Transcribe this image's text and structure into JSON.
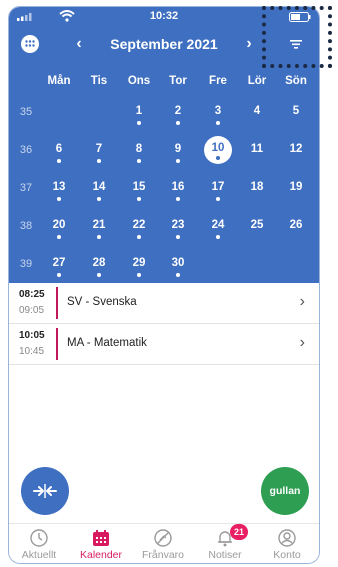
{
  "status": {
    "time": "10:32"
  },
  "header": {
    "month_title": "September 2021",
    "prev": "‹",
    "next": "›"
  },
  "weekdays": [
    "Mån",
    "Tis",
    "Ons",
    "Tor",
    "Fre",
    "Lör",
    "Sön"
  ],
  "weeks": [
    {
      "number": "35",
      "days": [
        {
          "n": "",
          "dot": false
        },
        {
          "n": "",
          "dot": false
        },
        {
          "n": "1",
          "dot": true
        },
        {
          "n": "2",
          "dot": true
        },
        {
          "n": "3",
          "dot": true
        },
        {
          "n": "4",
          "dot": false
        },
        {
          "n": "5",
          "dot": false
        }
      ]
    },
    {
      "number": "36",
      "days": [
        {
          "n": "6",
          "dot": true
        },
        {
          "n": "7",
          "dot": true
        },
        {
          "n": "8",
          "dot": true
        },
        {
          "n": "9",
          "dot": true
        },
        {
          "n": "10",
          "dot": true,
          "today": true
        },
        {
          "n": "11",
          "dot": false
        },
        {
          "n": "12",
          "dot": false
        }
      ]
    },
    {
      "number": "37",
      "days": [
        {
          "n": "13",
          "dot": true
        },
        {
          "n": "14",
          "dot": true
        },
        {
          "n": "15",
          "dot": true
        },
        {
          "n": "16",
          "dot": true
        },
        {
          "n": "17",
          "dot": true
        },
        {
          "n": "18",
          "dot": false
        },
        {
          "n": "19",
          "dot": false
        }
      ]
    },
    {
      "number": "38",
      "days": [
        {
          "n": "20",
          "dot": true
        },
        {
          "n": "21",
          "dot": true
        },
        {
          "n": "22",
          "dot": true
        },
        {
          "n": "23",
          "dot": true
        },
        {
          "n": "24",
          "dot": true
        },
        {
          "n": "25",
          "dot": false
        },
        {
          "n": "26",
          "dot": false
        }
      ]
    },
    {
      "number": "39",
      "days": [
        {
          "n": "27",
          "dot": true
        },
        {
          "n": "28",
          "dot": true
        },
        {
          "n": "29",
          "dot": true
        },
        {
          "n": "30",
          "dot": true
        },
        {
          "n": "",
          "dot": false
        },
        {
          "n": "",
          "dot": false
        },
        {
          "n": "",
          "dot": false
        }
      ]
    }
  ],
  "events": [
    {
      "start": "08:25",
      "end": "09:05",
      "title": "SV - Svenska",
      "color": "#c2185b"
    },
    {
      "start": "10:05",
      "end": "10:45",
      "title": "MA - Matematik",
      "color": "#c2185b"
    }
  ],
  "fab_right_label": "gullan",
  "tabs": [
    {
      "label": "Aktuellt",
      "icon": "clock-icon",
      "active": false
    },
    {
      "label": "Kalender",
      "icon": "calendar-icon",
      "active": true
    },
    {
      "label": "Frånvaro",
      "icon": "absence-icon",
      "active": false
    },
    {
      "label": "Notiser",
      "icon": "bell-icon",
      "active": false,
      "badge": "21"
    },
    {
      "label": "Konto",
      "icon": "account-icon",
      "active": false
    }
  ],
  "colors": {
    "header_blue": "#3f6fc0",
    "accent_pink": "#d81b60",
    "fab_green": "#2e9e53"
  }
}
